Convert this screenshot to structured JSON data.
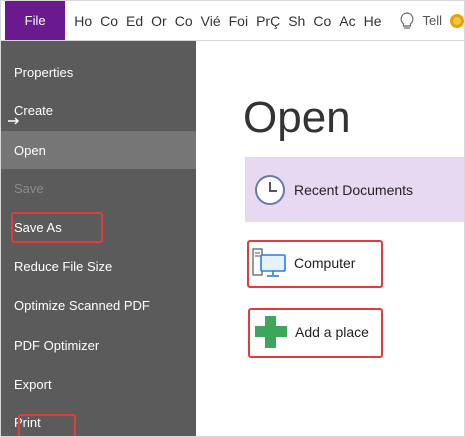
{
  "menu": {
    "file_label": "File",
    "tabs": [
      "Ho",
      "Co",
      "Ed",
      "Or",
      "Co",
      "Vié",
      "Foi",
      "PrÇ",
      "Sh",
      "Co",
      "Ac",
      "He"
    ],
    "tell_label": "Tell"
  },
  "sidebar": {
    "items": [
      {
        "label": "Properties",
        "state": "normal"
      },
      {
        "label": "Create",
        "state": "normal"
      },
      {
        "label": "Open",
        "state": "active"
      },
      {
        "label": "Save",
        "state": "disabled"
      },
      {
        "label": "Save As",
        "state": "highlighted"
      },
      {
        "label": "Reduce File Size",
        "state": "normal"
      },
      {
        "label": "Optimize Scanned PDF",
        "state": "normal"
      },
      {
        "label": "PDF Optimizer",
        "state": "normal"
      },
      {
        "label": "Export",
        "state": "normal"
      },
      {
        "label": "Print",
        "state": "highlighted"
      }
    ]
  },
  "main": {
    "title": "Open",
    "recent_label": "Recent Documents",
    "computer_label": "Computer",
    "add_place_label": "Add a place"
  },
  "colors": {
    "file_tab": "#6a1a8e",
    "sidebar_bg": "#5b5b5b",
    "sidebar_active": "#767676",
    "recent_bg": "#e7d9f1",
    "highlight_box": "#e03c3c",
    "plus_green": "#3da55c"
  },
  "icons": {
    "tell": "lightbulb-icon",
    "recent": "clock-icon",
    "computer": "computer-icon",
    "add_place": "plus-icon"
  }
}
